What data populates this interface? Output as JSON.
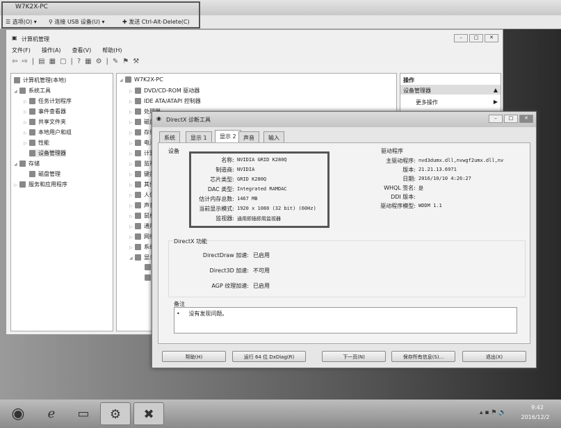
{
  "vm": {
    "title": "W7K2X-PC",
    "toolbar": [
      "选项(O)",
      "连接 USB 设备(U)",
      "发送 Ctrl-Alt-Delete(C)"
    ]
  },
  "cm": {
    "title": "计算机管理",
    "menu": [
      "文件(F)",
      "操作(A)",
      "查看(V)",
      "帮助(H)"
    ],
    "left_tree": [
      "计算机管理(本地)",
      "系统工具",
      "任务计划程序",
      "事件查看器",
      "共享文件夹",
      "本地用户和组",
      "性能",
      "设备管理器",
      "存储",
      "磁盘管理",
      "服务和应用程序"
    ],
    "device_tree": {
      "root": "W7K2X-PC",
      "items": [
        "DVD/CD-ROM 驱动器",
        "IDE ATA/ATAPI 控制器",
        "处理器",
        "磁盘驱动器",
        "存储控制器",
        "电池",
        "计算机",
        "监视器",
        "键盘",
        "其他设备",
        "人体学输入设备",
        "声音、视频和游戏控制器",
        "鼠标和其他指针设备",
        "通用串行总线控制器",
        "网络适配器",
        "系统设备",
        "显示适配器"
      ]
    },
    "actions": {
      "header": "操作",
      "section": "设备管理器",
      "more": "更多操作"
    }
  },
  "dx": {
    "title": "DirectX 诊断工具",
    "tabs": [
      "系统",
      "显示 1",
      "显示 2",
      "声音",
      "输入"
    ],
    "device": {
      "header": "设备",
      "rows": [
        [
          "名称:",
          "NVIDIA GRID K280Q"
        ],
        [
          "制造商:",
          "NVIDIA"
        ],
        [
          "芯片类型:",
          "GRID K280Q"
        ],
        [
          "DAC 类型:",
          "Integrated RAMDAC"
        ],
        [
          "估计内存总数:",
          "1467 MB"
        ],
        [
          "当前显示模式:",
          "1920 x 1080 (32 bit) (60Hz)"
        ],
        [
          "监视器:",
          "通用即插即用监视器"
        ]
      ]
    },
    "driver": {
      "header": "驱动程序",
      "rows": [
        [
          "主驱动程序:",
          "nvd3dumx.dll,nvwgf2umx.dll,nv"
        ],
        [
          "版本:",
          "21.21.13.6971"
        ],
        [
          "日期:",
          "2016/10/10 4:26:27"
        ],
        [
          "WHQL 签名:",
          "是"
        ],
        [
          "DDI 版本:",
          ""
        ],
        [
          "驱动程序模型:",
          "WDDM 1.1"
        ]
      ]
    },
    "features": {
      "header": "DirectX 功能",
      "rows": [
        [
          "DirectDraw 加速:",
          "已启用"
        ],
        [
          "Direct3D 加速:",
          "不可用"
        ],
        [
          "AGP 纹理加速:",
          "已启用"
        ]
      ]
    },
    "notes": {
      "header": "备注",
      "text": "没有发现问题。"
    },
    "buttons": [
      "帮助(H)",
      "运行 64 位 DxDiag(R)",
      "下一页(N)",
      "保存所有信息(S)...",
      "退出(X)"
    ]
  },
  "taskbar": {
    "time": "9:42",
    "date": "2016/12/2"
  }
}
